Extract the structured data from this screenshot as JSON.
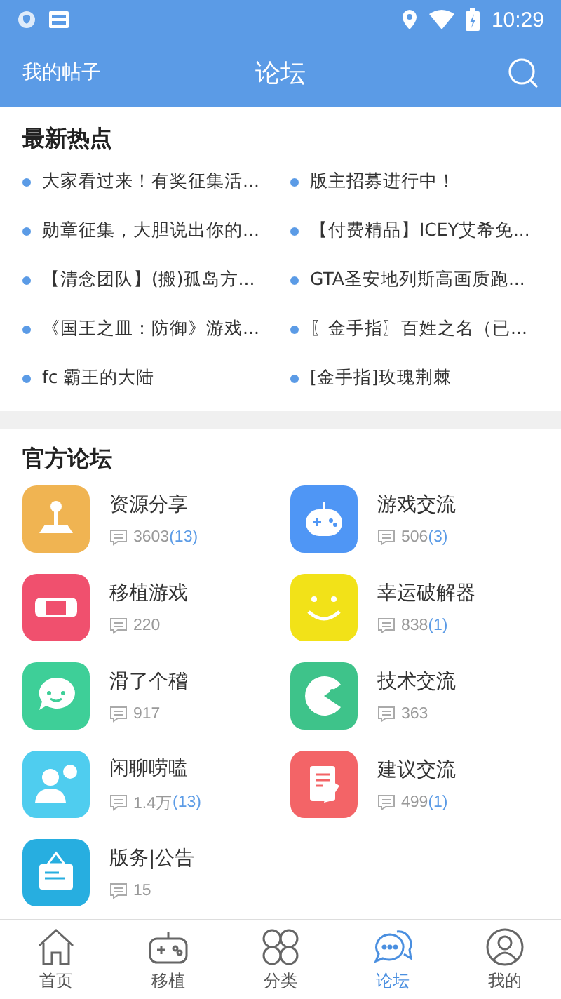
{
  "status_bar": {
    "time": "10:29"
  },
  "header": {
    "left_link": "我的帖子",
    "title": "论坛"
  },
  "hot": {
    "title": "最新热点",
    "items": [
      {
        "text": "大家看过来！有奖征集活..."
      },
      {
        "text": "版主招募进行中！"
      },
      {
        "text": "勋章征集，大胆说出你的..."
      },
      {
        "text": "【付费精品】ICEY艾希免..."
      },
      {
        "text": "【清念团队】(搬)孤岛方..."
      },
      {
        "text": "GTA圣安地列斯高画质跑..."
      },
      {
        "text": "《国王之皿：防御》游戏..."
      },
      {
        "text": "〖金手指〗百姓之名（已..."
      },
      {
        "text": "fc 霸王的大陆"
      },
      {
        "text": "[金手指]玫瑰荆棘"
      }
    ]
  },
  "forums": {
    "title": "官方论坛",
    "items": [
      {
        "name": "资源分享",
        "count": "3603",
        "new": "(13)",
        "color": "#f0b452",
        "kind": "joystick"
      },
      {
        "name": "游戏交流",
        "count": "506",
        "new": "(3)",
        "color": "#4f96f5",
        "kind": "gamepad"
      },
      {
        "name": "移植游戏",
        "count": "220",
        "color": "#f0506e",
        "kind": "handheld"
      },
      {
        "name": "幸运破解器",
        "count": "838",
        "new": "(1)",
        "color": "#f2e218",
        "kind": "smile"
      },
      {
        "name": "滑了个稽",
        "count": "917",
        "color": "#3ecf98",
        "kind": "chat"
      },
      {
        "name": "技术交流",
        "count": "363",
        "color": "#3ec38a",
        "kind": "pacman"
      },
      {
        "name": "闲聊唠嗑",
        "count": "1.4万",
        "new": "(13)",
        "color": "#4fcdef",
        "kind": "person"
      },
      {
        "name": "建议交流",
        "count": "499",
        "new": "(1)",
        "color": "#f36467",
        "kind": "note"
      },
      {
        "name": "版务|公告",
        "count": "15",
        "color": "#27aee0",
        "kind": "board"
      }
    ]
  },
  "tabs": [
    {
      "label": "首页",
      "kind": "home",
      "selected": false
    },
    {
      "label": "移植",
      "kind": "gamepad",
      "selected": false
    },
    {
      "label": "分类",
      "kind": "grid",
      "selected": false
    },
    {
      "label": "论坛",
      "kind": "forum",
      "selected": true
    },
    {
      "label": "我的",
      "kind": "user",
      "selected": false
    }
  ]
}
